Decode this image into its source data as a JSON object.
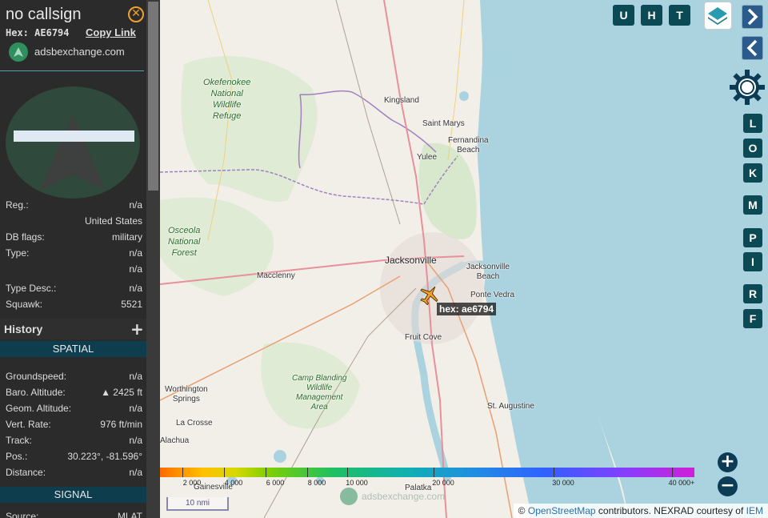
{
  "sidebar": {
    "callsign": "no callsign",
    "hex_label": "Hex:",
    "hex_value": "AE6794",
    "copy_link": "Copy Link",
    "site": "adsbexchange.com",
    "info_rows": [
      {
        "label": "Reg.:",
        "value": "n/a"
      },
      {
        "label": "",
        "value": "United States"
      },
      {
        "label": "DB flags:",
        "value": "military"
      },
      {
        "label": "Type:",
        "value": "n/a"
      },
      {
        "label": "",
        "value": "n/a"
      },
      {
        "label": "Type Desc.:",
        "value": "n/a"
      },
      {
        "label": "Squawk:",
        "value": "5521"
      }
    ],
    "history": "History",
    "history_toggle": "+",
    "spatial_header": "SPATIAL",
    "spatial_rows": [
      {
        "label": "Groundspeed:",
        "value": "n/a"
      },
      {
        "label": "Baro. Altitude:",
        "value": "▲ 2425 ft"
      },
      {
        "label": "Geom. Altitude:",
        "value": "n/a"
      },
      {
        "label": "Vert. Rate:",
        "value": "976 ft/min"
      },
      {
        "label": "Track:",
        "value": "n/a"
      },
      {
        "label": "Pos.:",
        "value": "30.223°, -81.596°"
      },
      {
        "label": "Distance:",
        "value": "n/a"
      }
    ],
    "signal_header": "SIGNAL",
    "signal_rows": [
      {
        "label": "Source:",
        "value": "MLAT"
      }
    ]
  },
  "map": {
    "places": {
      "kingsland": "Kingsland",
      "saint_marys": "Saint Marys",
      "fernandina": "Fernandina",
      "fernandina2": "Beach",
      "yulee": "Yulee",
      "jacksonville": "Jacksonville",
      "jax_beach": "Jacksonville",
      "jax_beach2": "Beach",
      "ponte_vedra": "Ponte Vedra",
      "macclenny": "Macclenny",
      "fruit_cove": "Fruit Cove",
      "worthington": "Worthington",
      "worthington2": "Springs",
      "la_crosse": "La Crosse",
      "alachua": "Alachua",
      "gainesville": "Gainesville",
      "palatka": "Palatka",
      "st_augustine": "St. Augustine",
      "okefenokee": [
        "Okefenokee",
        "National",
        "Wildlife",
        "Refuge"
      ],
      "osceola": [
        "Osceola",
        "National",
        "Forest"
      ],
      "camp_blanding": [
        "Camp Blanding",
        "Wildlife",
        "Management",
        "Area"
      ]
    },
    "aircraft_label": "hex: ae6794",
    "buttons": {
      "u": "U",
      "h": "H",
      "t": "T",
      "l": "L",
      "o": "O",
      "k": "K",
      "m": "M",
      "p": "P",
      "i": "I",
      "r": "R",
      "f": "F",
      "zoom_in": "+",
      "zoom_out": "−"
    },
    "altitude_legend": [
      "2 000",
      "4 000",
      "6 000",
      "8 000",
      "10 000",
      "20 000",
      "30 000",
      "40 000+"
    ],
    "scale": "10 nmi",
    "watermark": "adsbexchange.com",
    "attribution": {
      "prefix": "© ",
      "osm": "OpenStreetMap",
      "middle": " contributors. NEXRAD courtesy of ",
      "iem": "IEM"
    }
  },
  "colors": {
    "sidebar_bg": "#2b2b2b",
    "section_header": "#0e3e4e",
    "button": "#0b4a55",
    "aircraft": "#f0a030",
    "water": "#aad3df"
  }
}
